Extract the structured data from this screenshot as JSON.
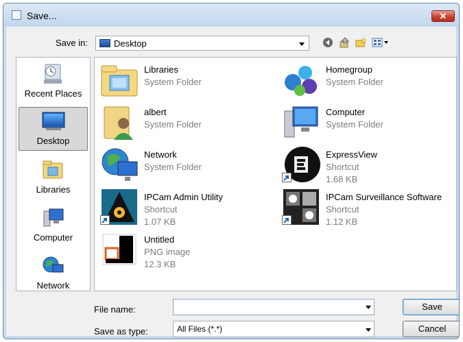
{
  "window": {
    "title": "Save...",
    "close_icon": "close-icon"
  },
  "save_in": {
    "label": "Save in:",
    "value": "Desktop"
  },
  "toolbar": {
    "icons": [
      "back-icon",
      "up-folder-icon",
      "new-folder-icon",
      "view-menu-icon"
    ]
  },
  "places": [
    {
      "label": "Recent Places",
      "icon": "recent-places-icon"
    },
    {
      "label": "Desktop",
      "icon": "desktop-icon",
      "selected": true
    },
    {
      "label": "Libraries",
      "icon": "libraries-icon"
    },
    {
      "label": "Computer",
      "icon": "computer-icon"
    },
    {
      "label": "Network",
      "icon": "network-icon"
    }
  ],
  "files": [
    {
      "name": "Libraries",
      "type": "System Folder",
      "icon": "libraries-folder-icon"
    },
    {
      "name": "Homegroup",
      "type": "System Folder",
      "icon": "homegroup-icon"
    },
    {
      "name": "albert",
      "type": "System Folder",
      "icon": "user-folder-icon"
    },
    {
      "name": "Computer",
      "type": "System Folder",
      "icon": "computer-icon"
    },
    {
      "name": "Network",
      "type": "System Folder",
      "icon": "network-icon"
    },
    {
      "name": "ExpressView",
      "type": "Shortcut",
      "size": "1.68 KB",
      "icon": "expressview-icon"
    },
    {
      "name": "IPCam Admin Utility",
      "type": "Shortcut",
      "size": "1.07 KB",
      "icon": "ipcam-admin-icon"
    },
    {
      "name": "IPCam Surveillance Software",
      "type": "Shortcut",
      "size": "1.12 KB",
      "icon": "ipcam-surveillance-icon"
    },
    {
      "name": "Untitled",
      "type": "PNG image",
      "size": "12.3 KB",
      "icon": "png-image-icon"
    }
  ],
  "file_name": {
    "label": "File name:",
    "value": ""
  },
  "save_as_type": {
    "label": "Save as type:",
    "value": "All Files (*.*)"
  },
  "buttons": {
    "save": "Save",
    "cancel": "Cancel"
  },
  "colors": {
    "accent": "#3c7fb1",
    "close": "#c8422e"
  }
}
